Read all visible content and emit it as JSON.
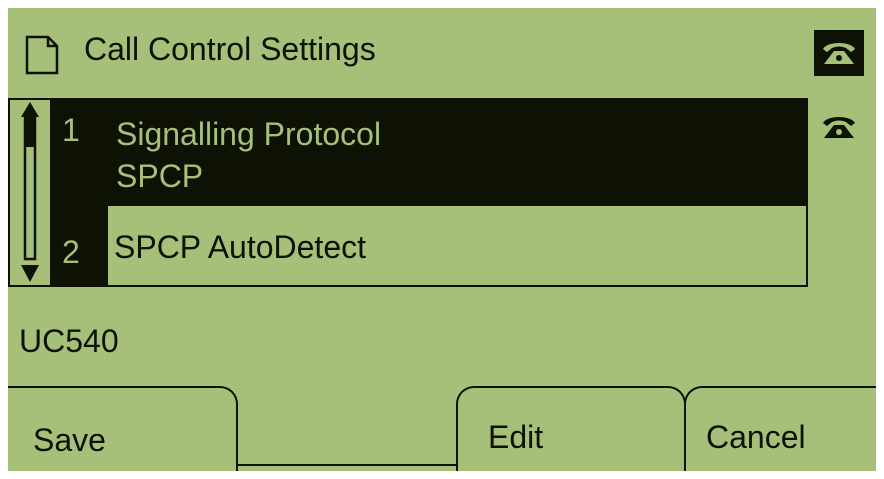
{
  "header": {
    "title": "Call Control Settings",
    "icon": "document-icon",
    "line_status_icons": [
      "phone-handset-icon",
      "phone-handset-icon"
    ]
  },
  "list": {
    "items": [
      {
        "number": "1",
        "label": "Signalling Protocol",
        "value": "SPCP",
        "selected": true
      },
      {
        "number": "2",
        "label": "SPCP AutoDetect",
        "value": "",
        "selected": false
      }
    ],
    "scroll_icons": [
      "up-arrow-icon",
      "down-arrow-icon"
    ]
  },
  "status": {
    "text": "UC540"
  },
  "softkeys": {
    "save": "Save",
    "edit": "Edit",
    "cancel": "Cancel"
  },
  "colors": {
    "lcd_background": "#a6c07a",
    "lcd_foreground": "#0d1205"
  }
}
